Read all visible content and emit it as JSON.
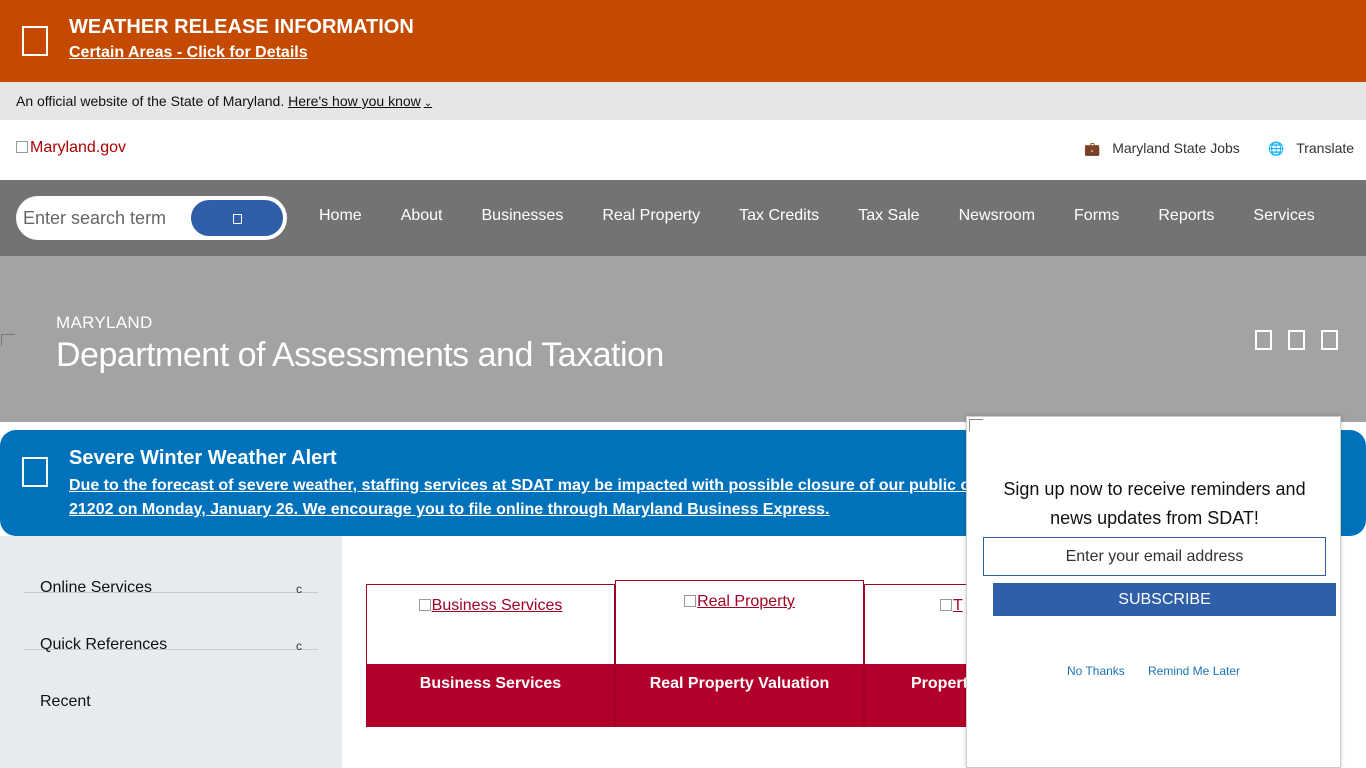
{
  "weather_banner": {
    "title": "WEATHER RELEASE INFORMATION",
    "link": "Certain Areas - Click for Details",
    "color": "#c44a00"
  },
  "official_banner": {
    "text": "An official website of the State of Maryland.",
    "link": "Here's how you know"
  },
  "header": {
    "logo_alt": "Maryland.gov",
    "jobs": "Maryland State Jobs",
    "translate": "Translate"
  },
  "nav": {
    "search_placeholder": "Enter search term",
    "items": [
      "Home",
      "About",
      "Businesses",
      "Real Property",
      "Tax Credits",
      "Tax Sale",
      "Newsroom",
      "Forms",
      "Reports",
      "Services"
    ]
  },
  "hero": {
    "kicker": "MARYLAND",
    "title": "Department of Assessments and Taxation"
  },
  "alert": {
    "title": "Severe Winter Weather Alert",
    "body_line1": "Due to the forecast of severe weather, staffing services at SDAT may be impacted with possible closure of our public c",
    "body_line2": "21202 on Monday, January 26. We encourage you to file online through Maryland Business Express.",
    "color": "#0072bb"
  },
  "sidebar": {
    "items": [
      {
        "label": "Online Services",
        "caret": "c"
      },
      {
        "label": "Quick References",
        "caret": "c"
      },
      {
        "label": "Recent",
        "caret": ""
      }
    ]
  },
  "cards": [
    {
      "image_alt": "Business Services",
      "label": "Business Services"
    },
    {
      "image_alt": "Real Property",
      "label": "Real Property Valuation"
    },
    {
      "image_alt": "T",
      "label": "Propert"
    }
  ],
  "popup": {
    "message": "Sign up now to receive reminders and news updates from SDAT!",
    "email_placeholder": "Enter your email address",
    "subscribe": "SUBSCRIBE",
    "no_thanks": "No Thanks",
    "remind_later": "Remind Me Later"
  }
}
